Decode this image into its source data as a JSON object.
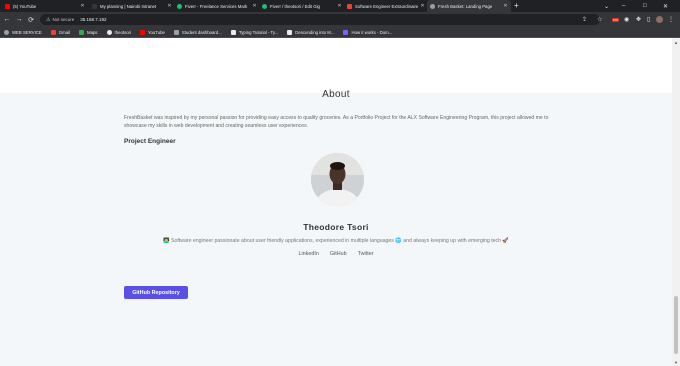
{
  "browser": {
    "tabs": [
      {
        "label": "(5) YouTube",
        "favicon_color": "#ff0000",
        "active": false
      },
      {
        "label": "My planning | Nairobi Intranet",
        "favicon_color": "#35363a",
        "active": false
      },
      {
        "label": "Fiverr - Freelance Services Mark",
        "favicon_color": "#1dbf73",
        "active": false
      },
      {
        "label": "Fiverr / theotsori / Edit Gig",
        "favicon_color": "#1dbf73",
        "active": false
      },
      {
        "label": "Software Engineer Extraordinaire",
        "favicon_color": "#ea4335",
        "active": false
      },
      {
        "label": "Fresh Basket: Landing Page",
        "favicon_color": "#9aa0a6",
        "active": true
      }
    ],
    "new_tab_symbol": "+",
    "window_controls": {
      "minimize": "–",
      "maximize": "□",
      "close": "✕"
    },
    "nav": {
      "back": "←",
      "forward": "→",
      "reload": "⟳"
    },
    "address_bar": {
      "security_label": "Not secure",
      "url": "35.168.7.192"
    },
    "bookmarks": [
      {
        "label": "WEB SERVICE",
        "icon_color": "#9aa0a6"
      },
      {
        "label": "Gmail",
        "icon_color": "#ea4335"
      },
      {
        "label": "Maps",
        "icon_color": "#34a853"
      },
      {
        "label": "theotsori",
        "icon_color": "#e8eaed"
      },
      {
        "label": "YouTube",
        "icon_color": "#ff0000"
      },
      {
        "label": "Student dashboard...",
        "icon_color": "#9aa0a6"
      },
      {
        "label": "Typing Tutorial - Ty...",
        "icon_color": "#e8eaed"
      },
      {
        "label": "Descending into M...",
        "icon_color": "#e8eaed"
      },
      {
        "label": "How it works - Dom...",
        "icon_color": "#7b61ff"
      }
    ]
  },
  "about": {
    "title": "About",
    "description": "FreshBasket was inspired by my personal passion for providing easy access to quality groceries. As a Portfolio Project for the ALX Software Engineering Program, this project allowed me to showcase my skills in web development and creating seamless user experiences.",
    "role": "Project Engineer"
  },
  "engineer": {
    "name": "Theodore Tsori",
    "bio": "👨‍💻 Software engineer passionate about user friendly applications, experienced in multiple languages 🌐 and always keeping up with emerging tech 🚀",
    "links": {
      "linkedin": "LinkedIn",
      "github": "GitHub",
      "twitter": "Twitter"
    }
  },
  "cta": {
    "github_repo_label": "GitHub Repository"
  },
  "colors": {
    "accent": "#5b50e6",
    "page_bg": "#f4f7f9"
  }
}
